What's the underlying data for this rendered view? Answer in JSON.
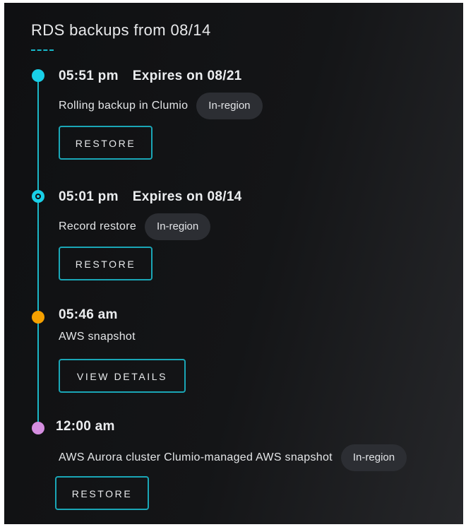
{
  "title": "RDS backups from 08/14",
  "entries": [
    {
      "time": "05:51 pm",
      "expires": "Expires on 08/21",
      "description": "Rolling backup in Clumio",
      "badge": "In-region",
      "button": "RESTORE",
      "dot_color": "#19d0e8",
      "dot_style": "filled"
    },
    {
      "time": "05:01 pm",
      "expires": "Expires on 08/14",
      "description": "Record restore",
      "badge": "In-region",
      "button": "RESTORE",
      "dot_color": "#19d0e8",
      "dot_style": "ring"
    },
    {
      "time": "05:46 am",
      "description": "AWS snapshot",
      "button": "VIEW DETAILS",
      "dot_color": "#f5a000",
      "dot_style": "filled"
    },
    {
      "time": "12:00 am",
      "description": "AWS Aurora cluster Clumio-managed AWS snapshot",
      "badge": "In-region",
      "button": "RESTORE",
      "dot_color": "#d58ee0",
      "dot_style": "filled"
    }
  ],
  "colors": {
    "accent": "#1bb6c6",
    "background": "#141517",
    "badge_bg": "#2c2e33"
  }
}
